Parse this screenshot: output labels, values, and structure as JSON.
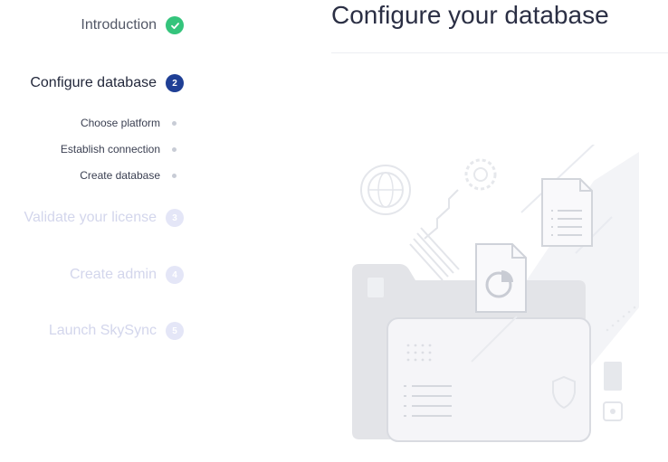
{
  "steps": [
    {
      "label": "Introduction",
      "status": "completed",
      "badge": "✓"
    },
    {
      "label": "Configure database",
      "status": "active",
      "badge": "2"
    },
    {
      "label": "Validate your license",
      "status": "upcoming",
      "badge": "3"
    },
    {
      "label": "Create admin",
      "status": "upcoming",
      "badge": "4"
    },
    {
      "label": "Launch SkySync",
      "status": "upcoming",
      "badge": "5"
    }
  ],
  "substeps": [
    {
      "label": "Choose platform"
    },
    {
      "label": "Establish connection"
    },
    {
      "label": "Create database"
    }
  ],
  "main": {
    "title": "Configure your database"
  },
  "colors": {
    "completed": "#34c47c",
    "active": "#1f3f95",
    "upcoming_badge": "#e4e6f7",
    "upcoming_text": "#d3d6ec"
  }
}
